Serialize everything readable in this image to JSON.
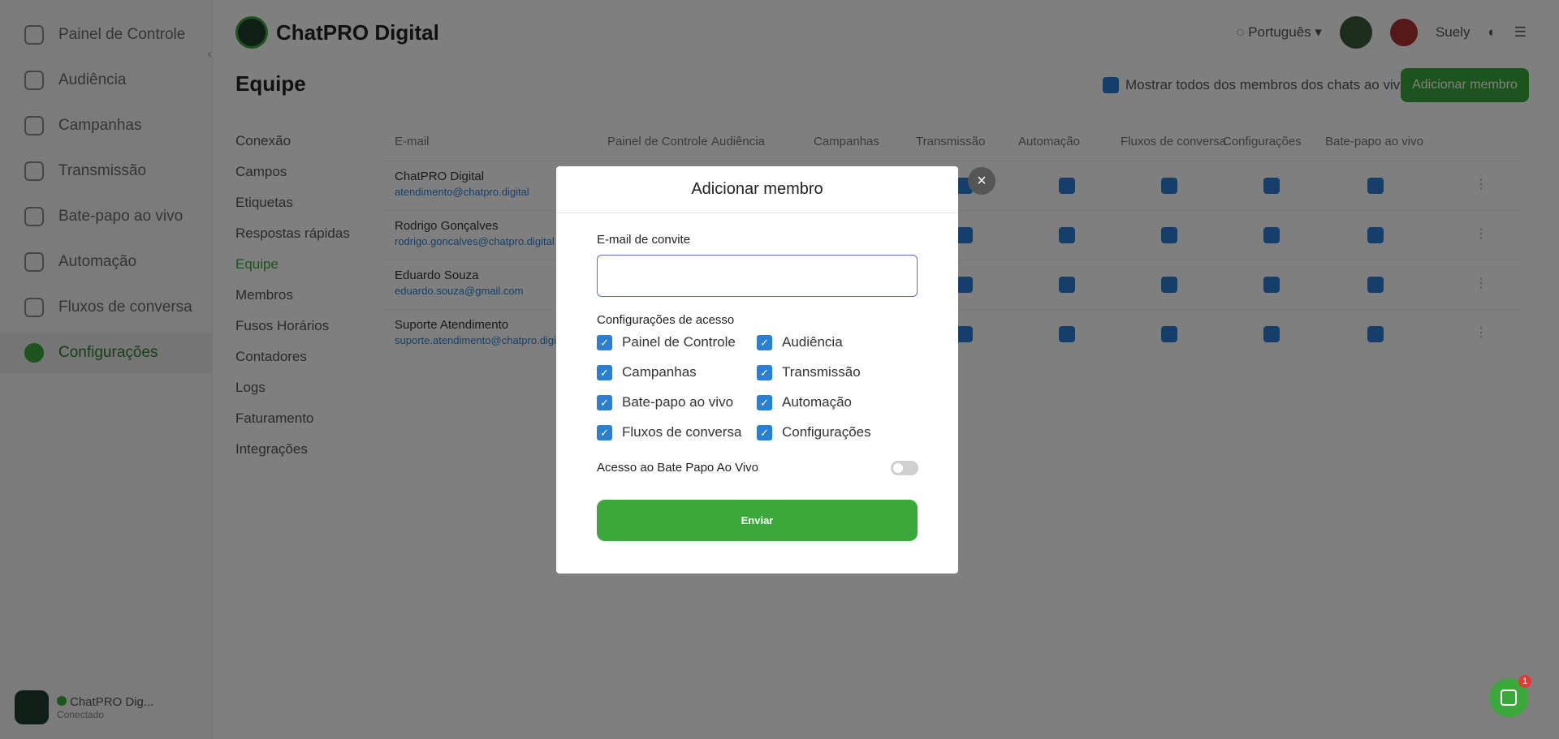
{
  "sidebar": {
    "items": [
      {
        "label": "Painel de Controle",
        "icon": "dashboard-icon"
      },
      {
        "label": "Audiência",
        "icon": "audience-icon"
      },
      {
        "label": "Campanhas",
        "icon": "campaign-icon"
      },
      {
        "label": "Transmissão",
        "icon": "broadcast-icon"
      },
      {
        "label": "Bate-papo ao vivo",
        "icon": "chat-icon"
      },
      {
        "label": "Automação",
        "icon": "automation-icon"
      },
      {
        "label": "Fluxos de conversa",
        "icon": "flow-icon"
      },
      {
        "label": "Configurações",
        "icon": "settings-icon"
      }
    ],
    "account_name": "ChatPRO Dig...",
    "account_sub": "Conectado"
  },
  "brand": {
    "name": "ChatPRO Digital"
  },
  "topbar": {
    "language": "Português",
    "user": "Suely"
  },
  "page": {
    "title": "Equipe",
    "subnav": [
      "Conexão",
      "Campos",
      "Etiquetas",
      "Respostas rápidas",
      "Equipe",
      "Membros",
      "Fusos Horários",
      "Contadores",
      "Logs",
      "Faturamento",
      "Integrações"
    ],
    "show_all_label": "Mostrar todos dos membros dos chats ao vivo",
    "add_button": "Adicionar membro"
  },
  "table": {
    "headers": [
      "E-mail",
      "Painel de Controle",
      "Audiência",
      "Campanhas",
      "Transmissão",
      "Automação",
      "Fluxos de conversa",
      "Configurações",
      "Bate-papo ao vivo"
    ],
    "rows": [
      {
        "name": "ChatPRO Digital",
        "email": "atendimento@chatpro.digital"
      },
      {
        "name": "Rodrigo Gonçalves",
        "email": "rodrigo.goncalves@chatpro.digital"
      },
      {
        "name": "Eduardo Souza",
        "email": "eduardo.souza@gmail.com"
      },
      {
        "name": "Suporte Atendimento",
        "email": "suporte.atendimento@chatpro.digital"
      }
    ]
  },
  "modal": {
    "title": "Adicionar membro",
    "email_label": "E-mail de convite",
    "email_value": "",
    "access_label": "Configurações de acesso",
    "permissions": [
      {
        "label": "Painel de Controle",
        "checked": true
      },
      {
        "label": "Audiência",
        "checked": true
      },
      {
        "label": "Campanhas",
        "checked": true
      },
      {
        "label": "Transmissão",
        "checked": true
      },
      {
        "label": "Bate-papo ao vivo",
        "checked": true
      },
      {
        "label": "Automação",
        "checked": true
      },
      {
        "label": "Fluxos de conversa",
        "checked": true
      },
      {
        "label": "Configurações",
        "checked": true
      }
    ],
    "live_chat_label": "Acesso ao Bate Papo Ao Vivo",
    "live_chat_enabled": false,
    "send_button": "Enviar"
  },
  "chat_widget": {
    "badge": "1"
  },
  "colors": {
    "accent": "#3aa83a",
    "checkbox": "#2a7fd4",
    "overlay": "rgba(0,0,0,0.5)"
  }
}
